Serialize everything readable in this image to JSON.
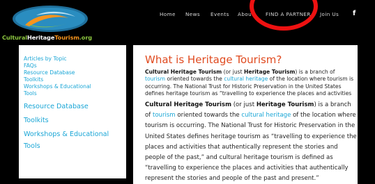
{
  "logo": {
    "text_cultural": "Cultural",
    "text_heritage": "Heritage",
    "text_tourism": "Tourism",
    "text_org": ".org"
  },
  "nav": {
    "home": "Home",
    "news": "News",
    "events": "Events",
    "about": "About",
    "find_partner": "FIND A PARTNER",
    "join_us": "Join Us",
    "facebook": "f"
  },
  "sidebar": {
    "small_items": [
      "Articles by Topic",
      "FAQs",
      "Resource Database",
      "Toolkits",
      "Workshops & Educational",
      "Tools"
    ],
    "large_items": [
      "Resource Database",
      "Toolkits",
      "Workshops & Educational",
      "Tools"
    ]
  },
  "main": {
    "title": "What is Heritage Tourism?",
    "small_paragraph": {
      "b1": "Cultural Heritage Tourism",
      "t1": " (or just ",
      "b2": "Heritage Tourism",
      "t2": ") is a branch of ",
      "l1": "tourism",
      "t3": " oriented towards the ",
      "l2": "cultural heritage",
      "t4": " of the location where tourism is occurring. The National Trust for Historic Preservation in the United States defines heritage tourism as “travelling to experience the places and activities that authentically"
    },
    "large_paragraph": {
      "b1": "Cultural Heritage Tourism",
      "t1": " (or just ",
      "b2": "Heritage Tourism",
      "t2": ") is a branch of ",
      "l1": "tourism",
      "t3": " oriented towards the ",
      "l2": "cultural heritage",
      "t4": " of the location where tourism is occurring. The National Trust for Historic Preservation in the United States defines heritage tourism as “travelling to experience the places and activities that authentically represent the stories and people of the past,” and cultural heritage tourism is defined as “travelling to experience the places and activities that authentically represent the stories and people of the past and present.”"
    }
  },
  "colors": {
    "accent_orange": "#e04a1f",
    "link_blue": "#1aa6d6",
    "annotation_red": "#ee1111"
  }
}
